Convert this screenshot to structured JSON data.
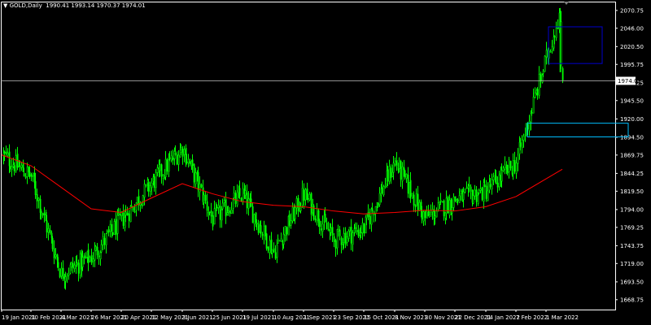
{
  "header": {
    "marker": "▼",
    "symbol": "GOLD,Daily",
    "ohlc": "1990.41 1993.14 1970.37 1974.01"
  },
  "colors": {
    "background": "#000000",
    "frame": "#ffffff",
    "bull_candle": "#00ff00",
    "bear_candle": "#00ff00",
    "moving_average": "#ff0000",
    "price_line": "#c0c0c0",
    "price_tag_bg": "#ffffff",
    "price_tag_text": "#000000",
    "box_upper": "#0000cd",
    "box_lower": "#00bfff"
  },
  "chart_data": {
    "type": "candlestick",
    "current_price_label": "1974.01",
    "ylim": [
      1655,
      2083
    ],
    "y_ticks": [
      "2070.75",
      "2046.00",
      "2020.50",
      "1995.75",
      "1970.25",
      "1945.50",
      "1920.00",
      "1894.50",
      "1869.75",
      "1844.25",
      "1819.50",
      "1794.00",
      "1769.25",
      "1743.75",
      "1719.00",
      "1693.50",
      "1668.75"
    ],
    "x_ticks": [
      "19 Jan 2021",
      "10 Feb 2021",
      "4 Mar 2021",
      "26 Mar 2021",
      "20 Apr 2021",
      "12 May 2021",
      "3 Jun 2021",
      "25 Jun 2021",
      "19 Jul 2021",
      "10 Aug 2021",
      "1 Sep 2021",
      "23 Sep 2021",
      "15 Oct 2021",
      "8 Nov 2021",
      "30 Nov 2021",
      "22 Dec 2021",
      "14 Jan 2022",
      "7 Feb 2022",
      "1 Mar 2022"
    ],
    "close_path": [
      [
        "19 Jan 2021",
        1870
      ],
      [
        "10 Feb 2021",
        1840
      ],
      [
        "4 Mar 2021",
        1705
      ],
      [
        "26 Mar 2021",
        1728
      ],
      [
        "20 Apr 2021",
        1780
      ],
      [
        "12 May 2021",
        1830
      ],
      [
        "3 Jun 2021",
        1880
      ],
      [
        "25 Jun 2021",
        1780
      ],
      [
        "19 Jul 2021",
        1815
      ],
      [
        "10 Aug 2021",
        1735
      ],
      [
        "1 Sep 2021",
        1815
      ],
      [
        "23 Sep 2021",
        1752
      ],
      [
        "15 Oct 2021",
        1768
      ],
      [
        "8 Nov 2021",
        1860
      ],
      [
        "30 Nov 2021",
        1782
      ],
      [
        "22 Dec 2021",
        1808
      ],
      [
        "14 Jan 2022",
        1820
      ],
      [
        "7 Feb 2022",
        1860
      ],
      [
        "1 Mar 2022",
        2065
      ],
      [
        "1 Mar 2022",
        1974
      ]
    ],
    "moving_average": [
      [
        "19 Jan 2021",
        1870
      ],
      [
        "10 Feb 2021",
        1855
      ],
      [
        "4 Mar 2021",
        1825
      ],
      [
        "26 Mar 2021",
        1795
      ],
      [
        "20 Apr 2021",
        1790
      ],
      [
        "12 May 2021",
        1810
      ],
      [
        "3 Jun 2021",
        1830
      ],
      [
        "25 Jun 2021",
        1816
      ],
      [
        "19 Jul 2021",
        1805
      ],
      [
        "10 Aug 2021",
        1800
      ],
      [
        "1 Sep 2021",
        1798
      ],
      [
        "23 Sep 2021",
        1792
      ],
      [
        "15 Oct 2021",
        1788
      ],
      [
        "8 Nov 2021",
        1790
      ],
      [
        "30 Nov 2021",
        1793
      ],
      [
        "22 Dec 2021",
        1792
      ],
      [
        "14 Jan 2022",
        1798
      ],
      [
        "7 Feb 2022",
        1812
      ],
      [
        "1 Mar 2022",
        1850
      ]
    ],
    "boxes": [
      {
        "name": "upper-zone",
        "x_start": "1 Mar 2022",
        "y_range": [
          1997,
          2048
        ],
        "color_key": "box_upper"
      },
      {
        "name": "lower-zone",
        "x_start": "7 Feb 2022",
        "y_range": [
          1895,
          1914
        ],
        "color_key": "box_lower"
      }
    ]
  }
}
